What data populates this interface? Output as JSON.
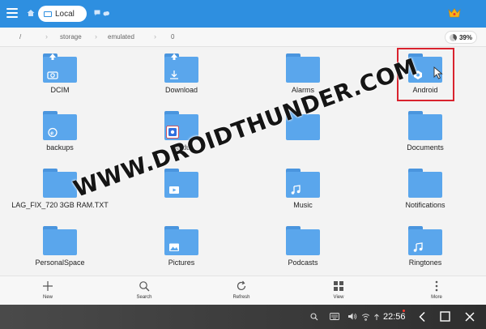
{
  "topbar": {
    "tab_label": "Local",
    "icons": [
      "menu-icon",
      "home-icon",
      "window-icon",
      "chat-icon",
      "cloud-icon",
      "crown-icon"
    ],
    "accent": "#2e8fe0"
  },
  "path": {
    "segments": [
      "/",
      "storage",
      "emulated",
      "0"
    ],
    "storage_percent": "39%"
  },
  "grid": {
    "items": [
      {
        "name": "DCIM",
        "badge": "camera-upload-icon"
      },
      {
        "name": "Download",
        "badge": "download-arrow-icon"
      },
      {
        "name": "Alarms",
        "badge": ""
      },
      {
        "name": "Android",
        "badge": "android-gear-icon",
        "highlighted": true
      },
      {
        "name": "backups",
        "badge": "e-badge-icon"
      },
      {
        "name": "baidu",
        "badge": "baidu-app-icon"
      },
      {
        "name": "",
        "badge": ""
      },
      {
        "name": "Documents",
        "badge": ""
      },
      {
        "name": "LAG_FIX_720 3GB RAM.TXT",
        "badge": ""
      },
      {
        "name": "",
        "badge": "video-play-icon"
      },
      {
        "name": "Music",
        "badge": "music-note-icon"
      },
      {
        "name": "Notifications",
        "badge": ""
      },
      {
        "name": "PersonalSpace",
        "badge": ""
      },
      {
        "name": "Pictures",
        "badge": "image-icon"
      },
      {
        "name": "Podcasts",
        "badge": ""
      },
      {
        "name": "Ringtones",
        "badge": "music-note-icon"
      }
    ]
  },
  "toolbar": {
    "new_label": "New",
    "search_label": "Search",
    "refresh_label": "Refresh",
    "view_label": "View",
    "more_label": "More"
  },
  "navbar": {
    "time": "22:56",
    "status_icons": [
      "search-icon",
      "keyboard-icon",
      "volume-icon",
      "wifi-icon",
      "signal-icon"
    ],
    "nav_icons": [
      "back-icon",
      "home-square-icon",
      "close-icon"
    ]
  },
  "watermark": "WWW.DROIDTHUNDER.COM"
}
